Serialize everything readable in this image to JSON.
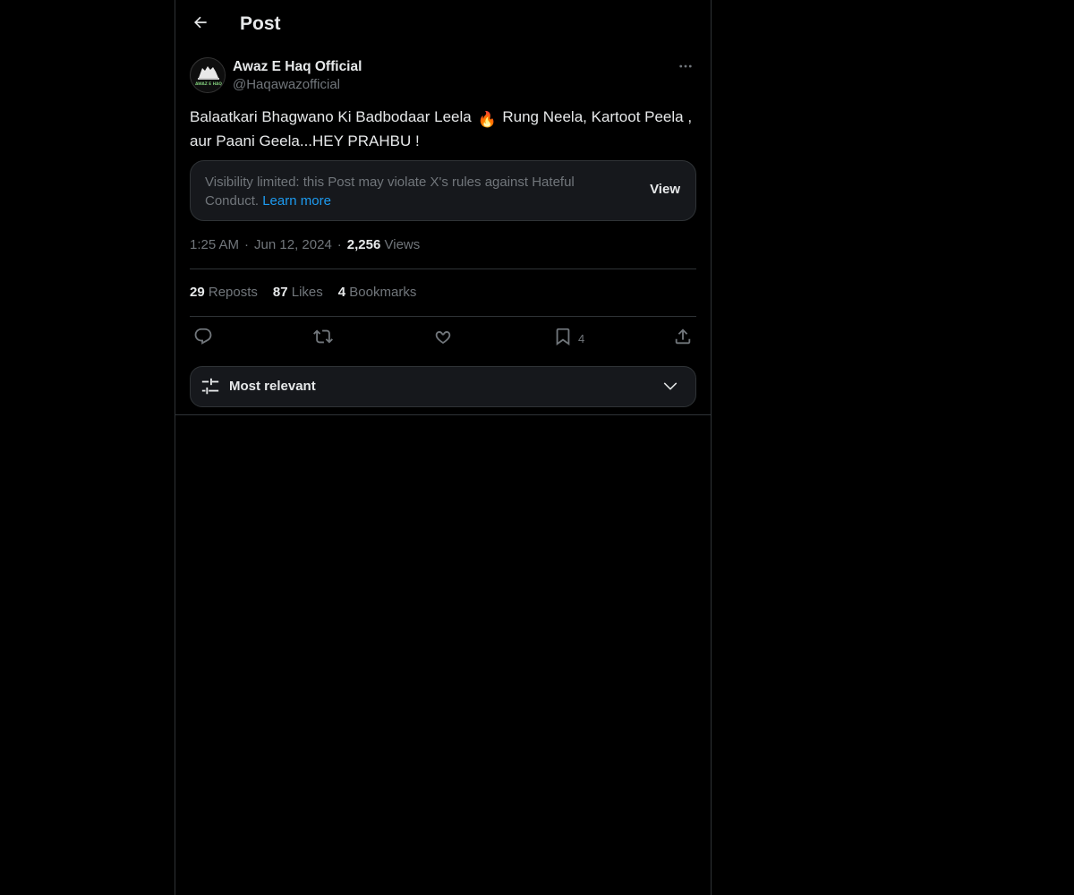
{
  "header": {
    "title": "Post",
    "back_icon": "arrow-left-icon"
  },
  "author": {
    "name": "Awaz E Haq Official",
    "handle": "@Haqawazofficial",
    "avatar_text": "AWAZ E HAQ"
  },
  "post": {
    "text_before": "Balaatkari Bhagwano Ki Badbodaar Leela",
    "emoji": "🔥",
    "text_after": "Rung Neela, Kartoot Peela , aur Paani Geela...HEY PRAHBU !"
  },
  "notice": {
    "text": "Visibility limited: this Post may violate X's rules against Hateful Conduct.",
    "link": "Learn more",
    "action": "View"
  },
  "meta": {
    "time": "1:25 AM",
    "separator": "·",
    "date": "Jun 12, 2024",
    "views_count": "2,256",
    "views_label": "Views"
  },
  "stats": {
    "reposts_count": "29",
    "reposts_label": "Reposts",
    "likes_count": "87",
    "likes_label": "Likes",
    "bookmarks_count": "4",
    "bookmarks_label": "Bookmarks"
  },
  "actions": {
    "reply_icon": "reply-icon",
    "repost_icon": "repost-icon",
    "like_icon": "heart-icon",
    "bookmark_icon": "bookmark-icon",
    "bookmark_count": "4",
    "share_icon": "share-icon"
  },
  "sort": {
    "label": "Most relevant",
    "icon": "sliders-icon"
  },
  "colors": {
    "background": "#000000",
    "text": "#e7e9ea",
    "muted": "#71767b",
    "accent": "#1d9bf0",
    "border": "#2f3336",
    "card": "#16181c"
  }
}
